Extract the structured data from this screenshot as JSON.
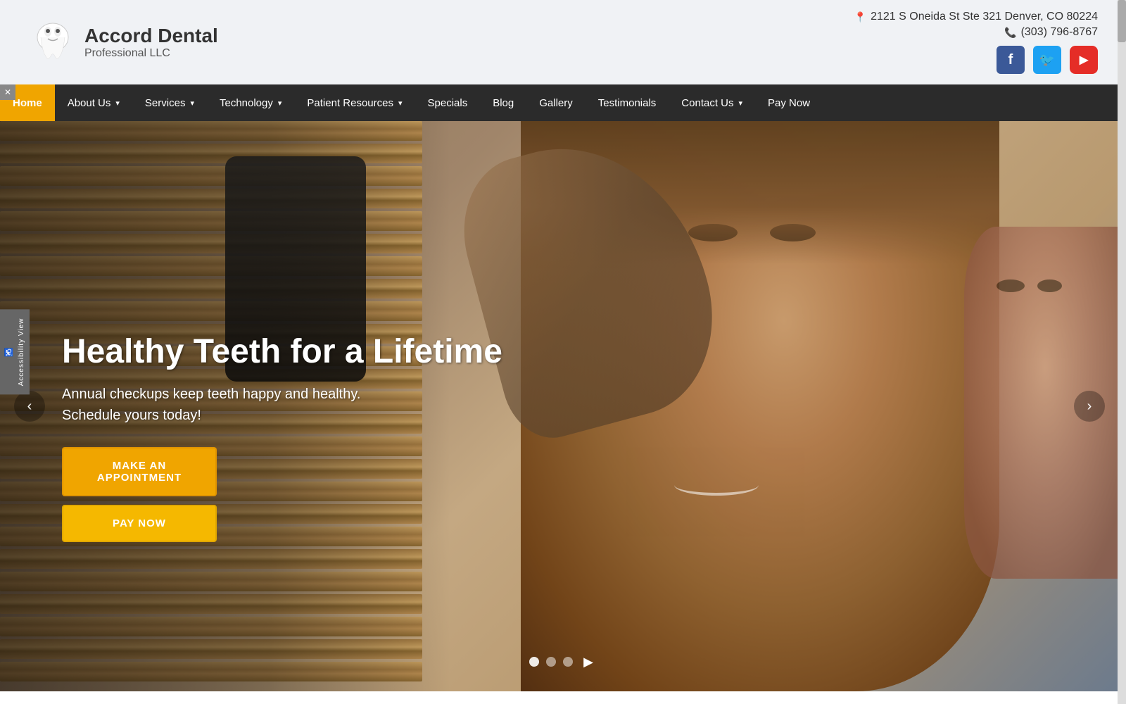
{
  "site": {
    "logo_name": "Accord Dental",
    "logo_sub": "Professional LLC",
    "address": "2121 S Oneida St Ste 321 Denver, CO 80224",
    "phone": "(303) 796-8767"
  },
  "social": {
    "facebook_label": "f",
    "twitter_label": "🐦",
    "youtube_label": "▶"
  },
  "nav": {
    "items": [
      {
        "label": "Home",
        "active": true,
        "has_dropdown": false
      },
      {
        "label": "About Us",
        "active": false,
        "has_dropdown": true
      },
      {
        "label": "Services",
        "active": false,
        "has_dropdown": true
      },
      {
        "label": "Technology",
        "active": false,
        "has_dropdown": true
      },
      {
        "label": "Patient Resources",
        "active": false,
        "has_dropdown": true
      },
      {
        "label": "Specials",
        "active": false,
        "has_dropdown": false
      },
      {
        "label": "Blog",
        "active": false,
        "has_dropdown": false
      },
      {
        "label": "Gallery",
        "active": false,
        "has_dropdown": false
      },
      {
        "label": "Testimonials",
        "active": false,
        "has_dropdown": false
      },
      {
        "label": "Contact Us",
        "active": false,
        "has_dropdown": true
      },
      {
        "label": "Pay Now",
        "active": false,
        "has_dropdown": false
      }
    ]
  },
  "hero": {
    "title": "Healthy Teeth for a Lifetime",
    "subtitle_line1": "Annual checkups keep teeth happy and healthy.",
    "subtitle_line2": "Schedule yours today!",
    "btn_appointment": "MAKE AN APPOINTMENT",
    "btn_pay": "PAY NOW"
  },
  "carousel": {
    "dots": 3,
    "active_dot": 0
  },
  "accessibility": {
    "label": "Accessibility View",
    "close_icon": "✕",
    "icon": "♿"
  }
}
